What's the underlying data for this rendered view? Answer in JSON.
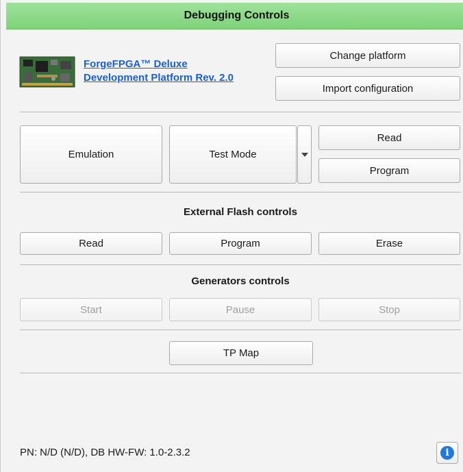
{
  "header": {
    "title": "Debugging Controls"
  },
  "platform": {
    "link_line1": "ForgeFPGA™ Deluxe",
    "link_line2": "Development Platform Rev. 2.0",
    "board_icon": "fpga-board-image",
    "change_label": "Change platform",
    "import_label": "Import configuration"
  },
  "mode": {
    "emulation_label": "Emulation",
    "test_mode_label": "Test Mode",
    "read_label": "Read",
    "program_label": "Program"
  },
  "external_flash": {
    "title": "External Flash controls",
    "read_label": "Read",
    "program_label": "Program",
    "erase_label": "Erase"
  },
  "generators": {
    "title": "Generators controls",
    "start_label": "Start",
    "pause_label": "Pause",
    "stop_label": "Stop"
  },
  "tp_map_label": "TP Map",
  "footer": {
    "status": "PN: N/D (N/D), DB HW-FW: 1.0-2.3.2",
    "info_icon": "info-icon"
  },
  "colors": {
    "header_green": "#8fdc8a",
    "link_blue": "#1a5fd0",
    "info_blue": "#1f7ad8"
  }
}
